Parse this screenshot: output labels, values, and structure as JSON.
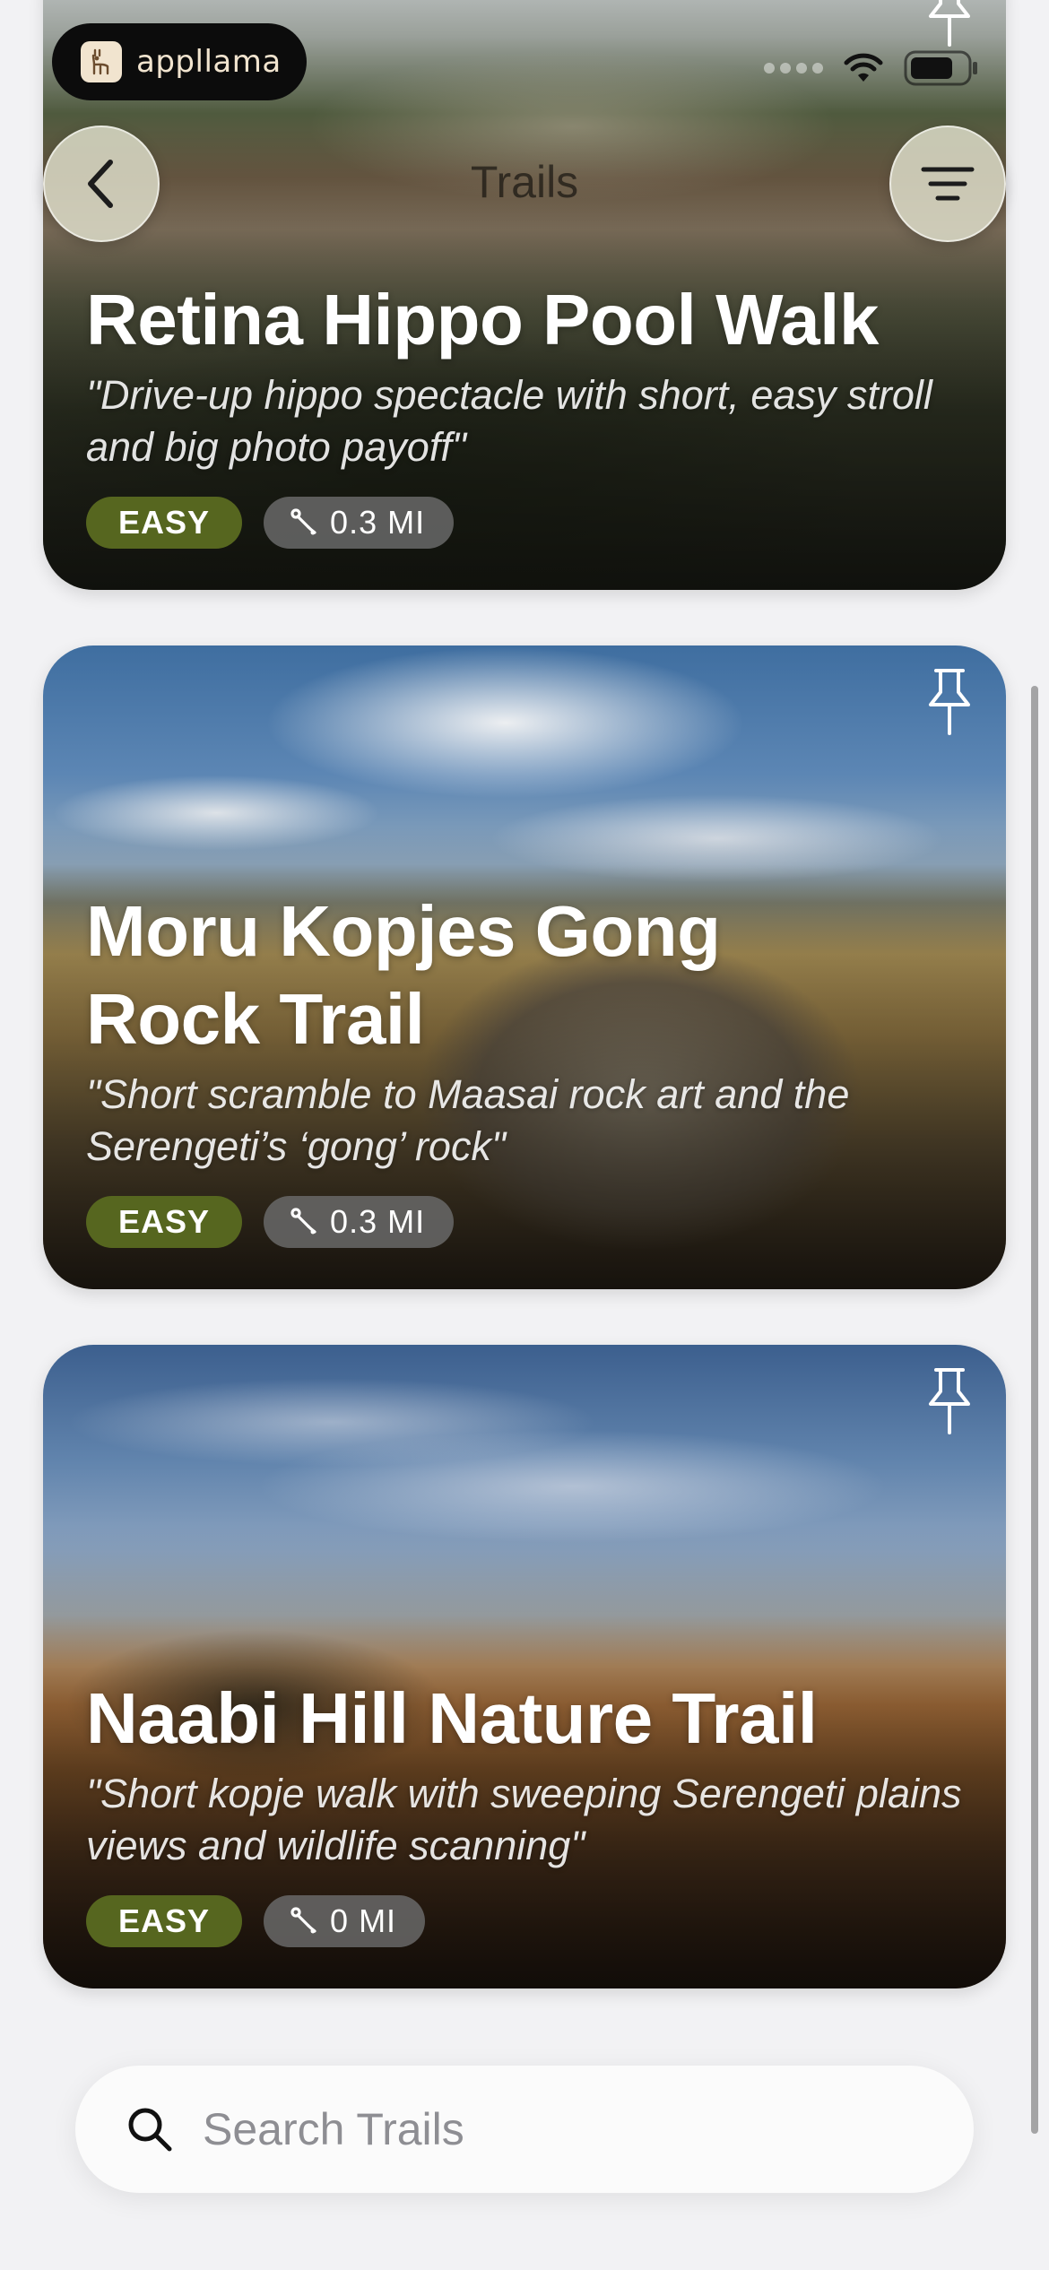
{
  "status_bar": {
    "brand": {
      "name": "appllama",
      "logo_icon": "llama-logo-icon"
    },
    "icons": [
      "signal-dots-icon",
      "wifi-icon",
      "battery-icon"
    ]
  },
  "nav": {
    "title": "Trails",
    "back_icon": "chevron-left-icon",
    "menu_icon": "filter-lines-icon"
  },
  "trails": [
    {
      "title": "Retina Hippo Pool Walk",
      "tagline": "\"Drive-up hippo spectacle with short, easy stroll and big photo payoff\"",
      "difficulty": "EASY",
      "distance": "0.3 MI",
      "pin_icon": "pin-icon"
    },
    {
      "title": "Moru Kopjes Gong Rock Trail",
      "tagline": "\"Short scramble to Maasai rock art and the Serengeti’s ‘gong’ rock\"",
      "difficulty": "EASY",
      "distance": "0.3 MI",
      "pin_icon": "pin-icon"
    },
    {
      "title": "Naabi Hill Nature Trail",
      "tagline": "\"Short kopje walk with sweeping Serengeti plains views and wildlife scanning\"",
      "difficulty": "EASY",
      "distance": "0 MI",
      "pin_icon": "pin-icon"
    }
  ],
  "search": {
    "placeholder": "Search Trails",
    "value": ""
  },
  "colors": {
    "difficulty_badge": "#56661f",
    "distance_badge": "#696969",
    "background": "#f2f2f4",
    "nav_button": "#e1e1cd"
  }
}
